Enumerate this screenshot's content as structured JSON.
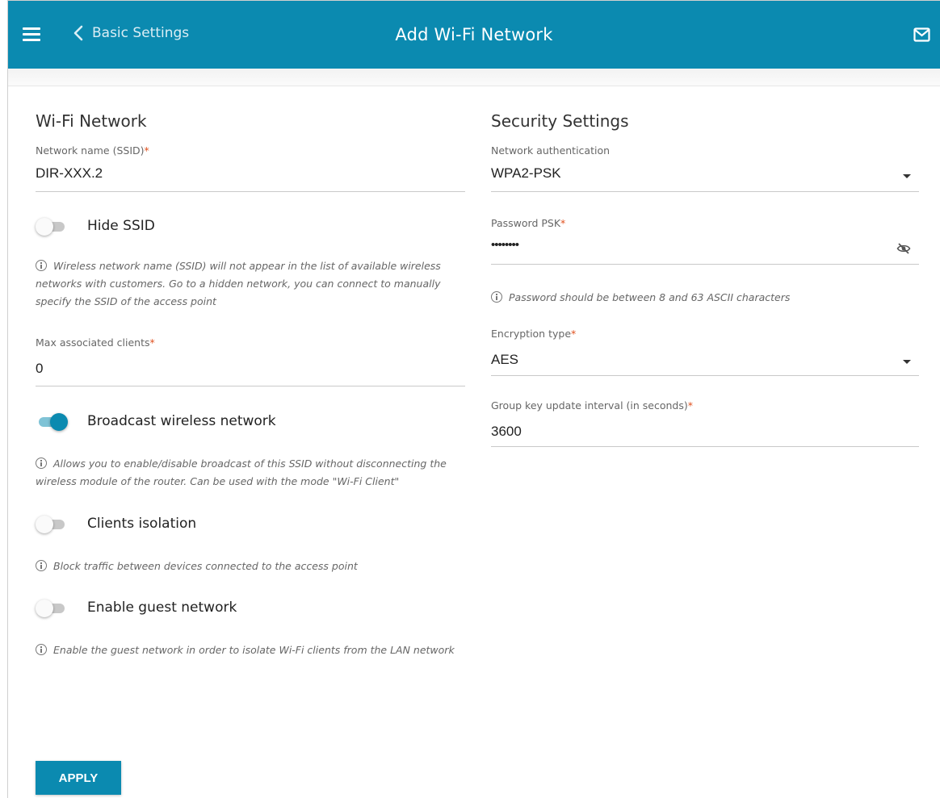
{
  "header": {
    "back_label": "Basic Settings",
    "title": "Add Wi-Fi Network",
    "bar_color": "#0b8ab0",
    "menu_icon": "hamburger-icon",
    "mail_icon": "mail-icon"
  },
  "wifi": {
    "section_title": "Wi-Fi Network",
    "ssid_label": "Network name (SSID)",
    "ssid_value": "DIR-XXX.2",
    "hide_ssid": {
      "label": "Hide SSID",
      "on": false
    },
    "hide_ssid_hint": "Wireless network name (SSID) will not appear in the list of available wireless networks with customers. Go to a hidden network, you can connect to manually specify the SSID of the access point",
    "max_clients_label": "Max associated clients",
    "max_clients_value": "0",
    "broadcast": {
      "label": "Broadcast wireless network",
      "on": true
    },
    "broadcast_hint": "Allows you to enable/disable broadcast of this SSID without disconnecting the wireless module of the router. Can be used with the mode \"Wi-Fi Client\"",
    "isolation": {
      "label": "Clients isolation",
      "on": false
    },
    "isolation_hint": "Block traffic between devices connected to the access point",
    "guest": {
      "label": "Enable guest network",
      "on": false
    },
    "guest_hint": "Enable the guest network in order to isolate Wi-Fi clients from the LAN network"
  },
  "security": {
    "section_title": "Security Settings",
    "auth_label": "Network authentication",
    "auth_value": "WPA2-PSK",
    "psk_label": "Password PSK",
    "psk_value": "••••••••",
    "psk_hint": "Password should be between 8 and 63 ASCII characters",
    "enc_label": "Encryption type",
    "enc_value": "AES",
    "gkui_label": "Group key update interval (in seconds)",
    "gkui_value": "3600"
  },
  "required_mark": "*",
  "apply_label": "APPLY",
  "accent_color": "#0b8ab0"
}
